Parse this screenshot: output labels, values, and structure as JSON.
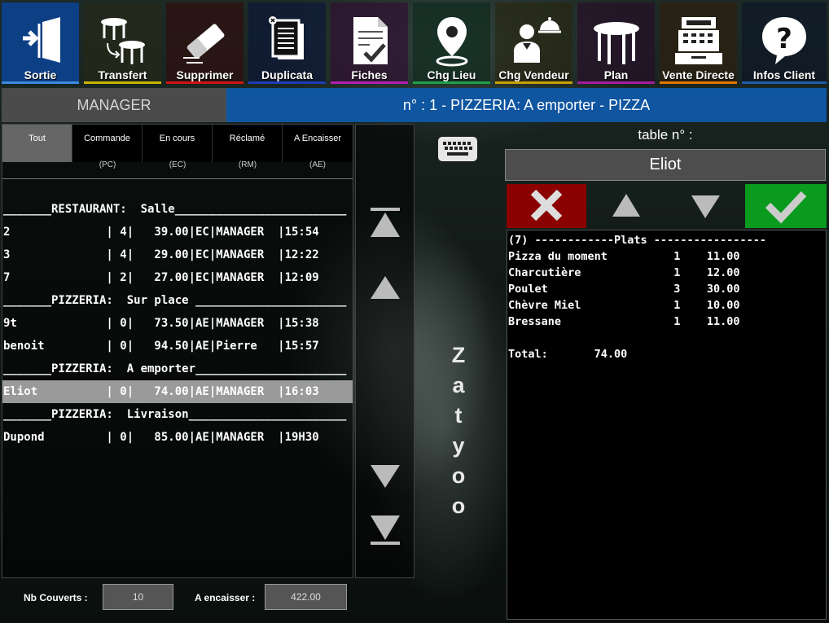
{
  "toolbar": {
    "buttons": [
      {
        "label": "Sortie",
        "icon": "exit-door-icon",
        "color": "#1e5aa8"
      },
      {
        "label": "Transfert",
        "icon": "table-transfer-icon",
        "color": "#c8b400"
      },
      {
        "label": "Supprimer",
        "icon": "eraser-icon",
        "color": "#d01414"
      },
      {
        "label": "Duplicata",
        "icon": "document-copy-icon",
        "color": "#1e3cb4"
      },
      {
        "label": "Fiches",
        "icon": "checked-document-icon",
        "color": "#b41eb4"
      },
      {
        "label": "Chg Lieu",
        "icon": "location-pin-icon",
        "color": "#1ea046"
      },
      {
        "label": "Chg Vendeur",
        "icon": "waiter-icon",
        "color": "#c8a000"
      },
      {
        "label": "Plan",
        "icon": "table-icon",
        "color": "#a01ea0"
      },
      {
        "label": "Vente Directe",
        "icon": "cash-register-icon",
        "color": "#e07800"
      },
      {
        "label": "Infos Client",
        "icon": "question-icon",
        "color": "#1e5aa8"
      }
    ]
  },
  "header": {
    "user": "MANAGER",
    "title": "n° : 1 - PIZZERIA: A emporter - PIZZA"
  },
  "orders": {
    "tabs": [
      {
        "label": "Tout",
        "code": ""
      },
      {
        "label": "Commande",
        "code": "(PC)"
      },
      {
        "label": "En cours",
        "code": "(EC)"
      },
      {
        "label": "Réclamé",
        "code": "(RM)"
      },
      {
        "label": "A Encaisser",
        "code": "(AE)"
      }
    ],
    "rows": [
      {
        "text": "_______RESTAURANT:  Salle_________________________",
        "selected": false
      },
      {
        "text": "2              | 4|   39.00|EC|MANAGER  |15:54",
        "selected": false
      },
      {
        "text": "3              | 4|   29.00|EC|MANAGER  |12:22",
        "selected": false
      },
      {
        "text": "7              | 2|   27.00|EC|MANAGER  |12:09",
        "selected": false
      },
      {
        "text": "_______PIZZERIA:  Sur place ______________________",
        "selected": false
      },
      {
        "text": "9t             | 0|   73.50|AE|MANAGER  |15:38",
        "selected": false
      },
      {
        "text": "benoit         | 0|   94.50|AE|Pierre   |15:57",
        "selected": false
      },
      {
        "text": "_______PIZZERIA:  A emporter______________________",
        "selected": false
      },
      {
        "text": "Eliot          | 0|   74.00|AE|MANAGER  |16:03",
        "selected": true
      },
      {
        "text": "_______PIZZERIA:  Livraison_______________________",
        "selected": false
      },
      {
        "text": "Dupond         | 0|   85.00|AE|MANAGER  |19H30",
        "selected": false
      }
    ]
  },
  "brand": [
    "Z",
    "a",
    "t",
    "y",
    "o",
    "o"
  ],
  "table": {
    "label": "table  n° :",
    "name": "Eliot"
  },
  "ticket": {
    "lines": [
      "(7) ------------Plats -----------------",
      "Pizza du moment          1    11.00",
      "Charcutière              1    12.00",
      "Poulet                   3    30.00",
      "Chèvre Miel              1    10.00",
      "Bressane                 1    11.00",
      "",
      "Total:       74.00"
    ]
  },
  "footer": {
    "covers_label": "Nb Couverts :",
    "covers_value": "10",
    "to_collect_label": "A encaisser :",
    "to_collect_value": "422.00"
  },
  "colors": {
    "header_blue": "#0f55a0",
    "cancel_red": "#8b0000",
    "confirm_green": "#0a9a1e"
  }
}
